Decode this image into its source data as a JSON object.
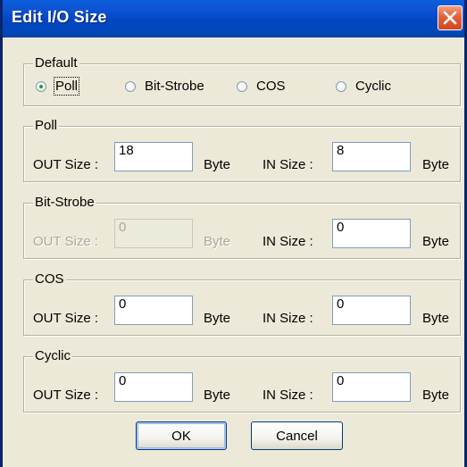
{
  "window": {
    "title": "Edit I/O Size"
  },
  "default_group": {
    "label": "Default",
    "options": [
      {
        "label": "Poll",
        "checked": true
      },
      {
        "label": "Bit-Strobe",
        "checked": false
      },
      {
        "label": "COS",
        "checked": false
      },
      {
        "label": "Cyclic",
        "checked": false
      }
    ]
  },
  "poll": {
    "label": "Poll",
    "out_label": "OUT Size :",
    "out_value": "18",
    "out_unit": "Byte",
    "in_label": "IN Size :",
    "in_value": "8",
    "in_unit": "Byte"
  },
  "bit_strobe": {
    "label": "Bit-Strobe",
    "out_label": "OUT Size :",
    "out_value": "0",
    "out_unit": "Byte",
    "in_label": "IN Size :",
    "in_value": "0",
    "in_unit": "Byte"
  },
  "cos": {
    "label": "COS",
    "out_label": "OUT Size :",
    "out_value": "0",
    "out_unit": "Byte",
    "in_label": "IN Size :",
    "in_value": "0",
    "in_unit": "Byte"
  },
  "cyclic": {
    "label": "Cyclic",
    "out_label": "OUT Size :",
    "out_value": "0",
    "out_unit": "Byte",
    "in_label": "IN Size :",
    "in_value": "0",
    "in_unit": "Byte"
  },
  "buttons": {
    "ok": "OK",
    "cancel": "Cancel"
  },
  "colors": {
    "title_bar": "#0346c4",
    "dialog_face": "#ece9d8",
    "close_button": "#e2613a",
    "radio_dot": "#21a121"
  }
}
